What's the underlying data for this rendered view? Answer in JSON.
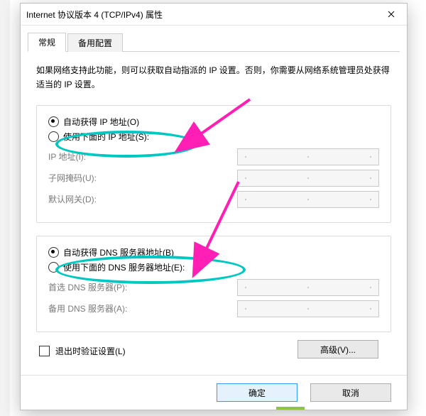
{
  "window": {
    "title": "Internet 协议版本 4 (TCP/IPv4) 属性"
  },
  "tabs": {
    "general": "常规",
    "alternate": "备用配置"
  },
  "intro": "如果网络支持此功能，则可以获取自动指派的 IP 设置。否则，你需要从网络系统管理员处获得适当的 IP 设置。",
  "ip_section": {
    "auto": "自动获得 IP 地址(O)",
    "manual": "使用下面的 IP 地址(S):",
    "ip_label": "IP 地址(I):",
    "mask_label": "子网掩码(U):",
    "gateway_label": "默认网关(D):"
  },
  "dns_section": {
    "auto": "自动获得 DNS 服务器地址(B)",
    "manual": "使用下面的 DNS 服务器地址(E):",
    "preferred_label": "首选 DNS 服务器(P):",
    "alternate_label": "备用 DNS 服务器(A):"
  },
  "validate_label": "退出时验证设置(L)",
  "buttons": {
    "advanced": "高级(V)...",
    "ok": "确定",
    "cancel": "取消"
  }
}
